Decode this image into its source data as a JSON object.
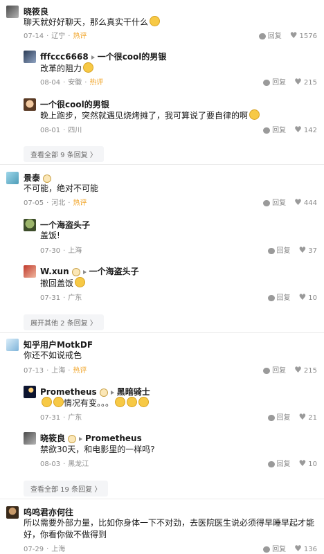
{
  "c1": {
    "name": "晓筱良",
    "content": "聊天就好好聊天，那么真实干什么",
    "date": "07-14",
    "loc": "辽宁",
    "hot": "热评",
    "reply": "回复",
    "likes": "1576"
  },
  "r1": {
    "name": "fffccc6668",
    "to": "一个很cool的男银",
    "content": "改革的阻力",
    "date": "08-04",
    "loc": "安徽",
    "hot": "热评",
    "reply": "回复",
    "likes": "215"
  },
  "r2": {
    "name": "一个很cool的男银",
    "content": "晚上跑步，突然就遇见烧烤摊了，我可算说了要自律的啊",
    "date": "08-01",
    "loc": "四川",
    "reply": "回复",
    "likes": "142"
  },
  "more1": "查看全部 9 条回复 〉",
  "c2": {
    "name": "景泰",
    "content": "不可能，绝对不可能",
    "date": "07-05",
    "loc": "河北",
    "hot": "热评",
    "reply": "回复",
    "likes": "444"
  },
  "r3": {
    "name": "一个海盗头子",
    "content": "盖饭!",
    "date": "07-30",
    "loc": "上海",
    "reply": "回复",
    "likes": "37"
  },
  "r4": {
    "name": "W.xun",
    "to": "一个海盗头子",
    "content": "撤回盖饭",
    "date": "07-31",
    "loc": "广东",
    "reply": "回复",
    "likes": "10"
  },
  "more2": "展开其他 2 条回复 〉",
  "c3": {
    "name": "知乎用户MotkDF",
    "content": "你还不如说戒色",
    "date": "07-13",
    "loc": "上海",
    "hot": "热评",
    "reply": "回复",
    "likes": "215"
  },
  "r5": {
    "name": "Prometheus",
    "to": "黑暗骑士",
    "content": "情况有变。。。",
    "date": "07-31",
    "loc": "广东",
    "reply": "回复",
    "likes": "21"
  },
  "r6": {
    "name": "晓筱良",
    "to": "Prometheus",
    "content": "禁欲30天，和电影里的一样吗?",
    "date": "08-03",
    "loc": "黑龙江",
    "reply": "回复",
    "likes": "10"
  },
  "more3": "查看全部 19 条回复 〉",
  "c4": {
    "name": "呜呜君亦何往",
    "content": "所以需要外部力量，比如你身体一下不对劲，去医院医生说必须得早睡早起才能好，你看你做不做得到",
    "date": "07-29",
    "loc": "上海",
    "reply": "回复",
    "likes": "136"
  },
  "colors": {
    "hot": "#f1a325",
    "meta": "#8a8a8a",
    "button_bg": "#f4f5f7"
  }
}
